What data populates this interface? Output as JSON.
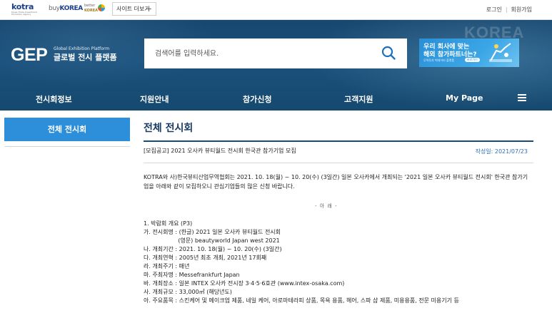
{
  "top_bar": {
    "kotra_logo": "kotra",
    "kotra_logo_sub": "Korea Trade-Investment Promotion Agency",
    "buykorea_logo_a": "buy",
    "buykorea_logo_b": "KOREA",
    "better_logo_a": "better",
    "better_logo_b": "KOREA",
    "site_more_label": "사이트 더보기",
    "login": "로그인",
    "signup": "회원가입"
  },
  "brand": {
    "gep": "GEP",
    "sub_en": "Global Exhibition Platform",
    "sub_ko": "글로벌 전시 플랫폼"
  },
  "search": {
    "placeholder": "검색어를 입력하세요."
  },
  "banner": {
    "line1": "우리 회사에 맞는",
    "line2": "해외 참가파트너는?",
    "line3": "무역투자 빅데이터 플랫폼",
    "pill": "바로가기",
    "watermark": "KOREA"
  },
  "nav": {
    "items": [
      "전시회정보",
      "지원안내",
      "참가신청",
      "고객지원",
      "My Page"
    ]
  },
  "sidebar": {
    "active_item": "전체 전시회"
  },
  "main": {
    "page_title": "전체 전시회",
    "post_title": "[모집공고] 2021 오사카 뷰티월드 전시회 한국관 참가기업 모집",
    "post_date": "작성일: 2021/07/23",
    "intro": "KOTRA와 사)한국뷰티산업무역협회는 2021. 10. 18(월) ~ 10. 20(수) (3일간) 일본 오사카에서 개최되는 '2021 일본 오사카 뷰티월드 전시회' 한국관 참가기업을 아래와 같이 모집하오니 관심기업들의 많은 신청 바랍니다.",
    "separator": "- 아   래 -",
    "list": [
      "1. 박람회 개요 (P3)",
      " 가. 전시회명 : (한글) 2021 일본 오사카 뷰티월드 전시회",
      "                   (영문) beautyworld Japan west 2021",
      " 나. 개최기간 : 2021. 10. 18(월) ~ 10. 20(수) (3일간)",
      " 다. 개최연혁 : 2005년 최초 개최, 2021년 17회째",
      " 라. 개최주기 : 매년",
      " 마. 주최자명 : Messefrankfurt Japan",
      " 바. 개최장소 : 일본 INTEX 오사카 전시장 3·4·5·6호관 (www.intex-osaka.com)",
      " 사. 개최규모 : 33,000㎡ (해당년도)",
      " 아. 주요품목 : 스킨케어 및 메이크업 제품, 네일 케어, 아로마테라피 상품, 목욕 용품, 헤어, 스파 샵 제품, 미용용품, 전문 미용기기 등"
    ]
  },
  "colors": {
    "hero": "#1a517c",
    "accent": "#2d8fd9",
    "title": "#183b63",
    "date": "#2d6fb7"
  }
}
